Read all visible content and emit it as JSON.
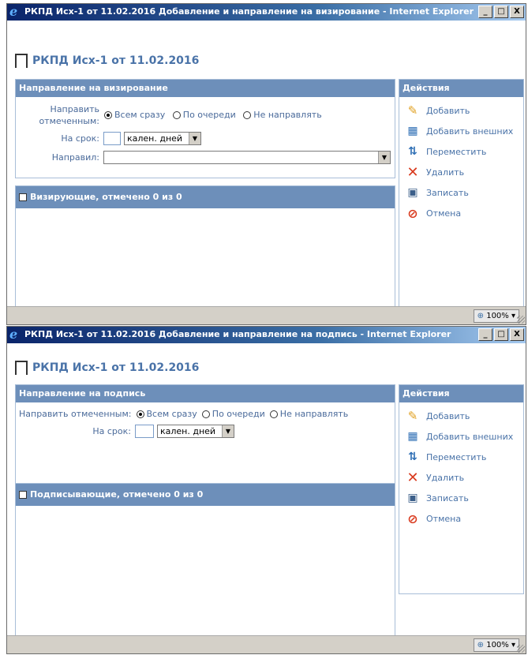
{
  "window1": {
    "title": "РКПД Исх-1 от 11.02.2016 Добавление и направление на визирование - Internet Explorer",
    "doc_title": "РКПД Исх-1 от 11.02.2016",
    "section_title": "Направление на визирование",
    "send_label_line1": "Направить",
    "send_label_line2": "отмеченным:",
    "radio_all": "Всем сразу",
    "radio_queue": "По очереди",
    "radio_none": "Не направлять",
    "term_label": "На срок:",
    "term_value": "",
    "term_unit": "кален. дней",
    "sent_by_label": "Направил:",
    "sent_by_value": "",
    "list_title": "Визирующие, отмечено 0 из 0",
    "zoom": "100%"
  },
  "window2": {
    "title": "РКПД Исх-1 от 11.02.2016 Добавление и направление на подпись - Internet Explorer",
    "doc_title": "РКПД Исх-1 от 11.02.2016",
    "section_title": "Направление на подпись",
    "send_label": "Направить отмеченным:",
    "radio_all": "Всем сразу",
    "radio_queue": "По очереди",
    "radio_none": "Не направлять",
    "term_label": "На срок:",
    "term_value": "",
    "term_unit": "кален. дней",
    "list_title": "Подписывающие, отмечено 0 из 0",
    "zoom": "100%"
  },
  "actions": {
    "title": "Действия",
    "items": [
      {
        "label": "Добавить",
        "icon": "add-icon"
      },
      {
        "label": "Добавить внешних",
        "icon": "add-external-icon"
      },
      {
        "label": "Переместить",
        "icon": "move-icon"
      },
      {
        "label": "Удалить",
        "icon": "delete-icon"
      },
      {
        "label": "Записать",
        "icon": "save-icon"
      },
      {
        "label": "Отмена",
        "icon": "cancel-icon"
      }
    ]
  },
  "window_buttons": {
    "minimize": "_",
    "maximize": "□",
    "close": "X"
  },
  "colors": {
    "header": "#6d8fba",
    "title_text": "#4a73a8",
    "titlebar": "#0a246a"
  }
}
